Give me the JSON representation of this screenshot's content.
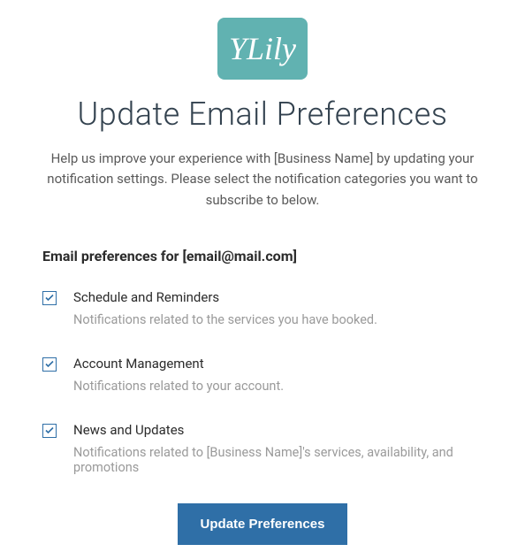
{
  "logo": {
    "text": "YLily"
  },
  "header": {
    "title": "Update Email Preferences",
    "intro": "Help us improve your experience with [Business Name] by updating your notification settings. Please select the notification categories you want to subscribe to below."
  },
  "preferences_label": "Email preferences for [email@mail.com]",
  "options": [
    {
      "title": "Schedule and Reminders",
      "description": "Notifications related to the services you have booked.",
      "checked": true
    },
    {
      "title": "Account Management",
      "description": "Notifications related to your account.",
      "checked": true
    },
    {
      "title": "News and Updates",
      "description": "Notifications related to [Business Name]'s services, availability, and promotions",
      "checked": true
    }
  ],
  "button": {
    "label": "Update Preferences"
  }
}
